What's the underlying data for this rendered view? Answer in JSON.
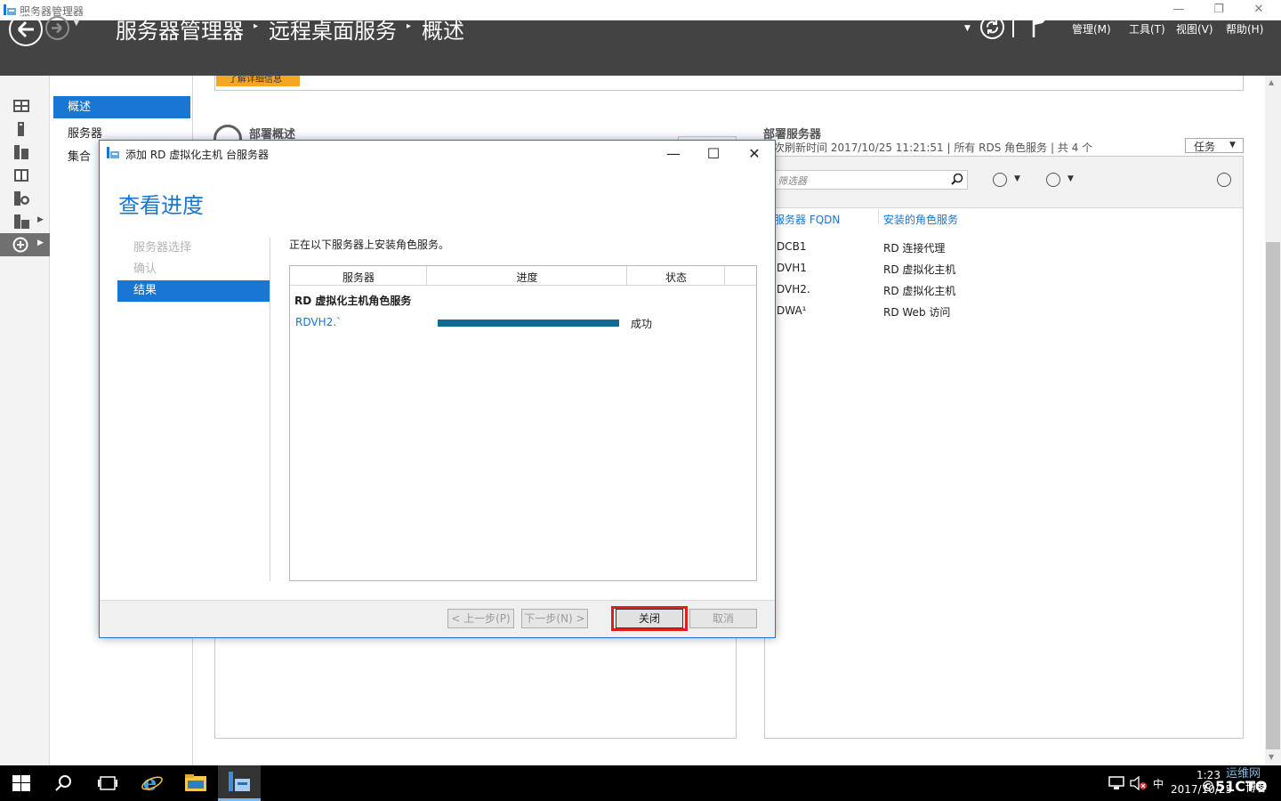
{
  "window": {
    "title": "服务器管理器",
    "minimize": "—",
    "restore": "❐",
    "close": "✕"
  },
  "header": {
    "breadcrumb": [
      "服务器管理器",
      "远程桌面服务",
      "概述"
    ],
    "menus": [
      "管理(M)",
      "工具(T)",
      "视图(V)",
      "帮助(H)"
    ]
  },
  "details_tab": "了解详细信息",
  "nav": {
    "items": [
      "概述",
      "服务器",
      "集合"
    ]
  },
  "deployment_overview": {
    "title": "部署概述"
  },
  "deployment_servers": {
    "title": "部署服务器",
    "subtitle": "次刷新时间 2017/10/25 11:21:51 | 所有 RDS 角色服务 | 共 4 个",
    "tasks_button": "任务",
    "filter_placeholder": "筛选器",
    "columns": [
      "服务器 FQDN",
      "安装的角色服务"
    ],
    "rows": [
      {
        "fqdn": "DCB1",
        "role": "RD 连接代理"
      },
      {
        "fqdn": "DVH1",
        "role": "RD 虚拟化主机"
      },
      {
        "fqdn": "DVH2.",
        "role": "RD 虚拟化主机"
      },
      {
        "fqdn": "DWA¹",
        "role": "RD Web 访问"
      }
    ]
  },
  "dialog": {
    "title": "添加 RD 虚拟化主机 台服务器",
    "heading": "查看进度",
    "steps": [
      "服务器选择",
      "确认",
      "结果"
    ],
    "active_step": 2,
    "description": "正在以下服务器上安装角色服务。",
    "table_columns": [
      "服务器",
      "进度",
      "状态"
    ],
    "group_title": "RD 虚拟化主机角色服务",
    "rows": [
      {
        "server": "RDVH2.`",
        "progress": 1.0,
        "status": "成功"
      }
    ],
    "buttons": {
      "prev": "< 上一步(P)",
      "next": "下一步(N) >",
      "close": "关闭",
      "cancel": "取消"
    },
    "min": "—",
    "max": "☐",
    "close_x": "✕"
  },
  "taskbar": {
    "time": "1:23",
    "date": "2017/10/25",
    "ime": "中",
    "watermark_top": "运维网",
    "watermark_mid": "©51CTO",
    "watermark_right": "博客"
  },
  "colors": {
    "accent": "#1976d2",
    "header_bg": "#434343",
    "progress": "#0f6c93",
    "highlight": "#e21d1d",
    "taskbar_bg": "#000000"
  }
}
